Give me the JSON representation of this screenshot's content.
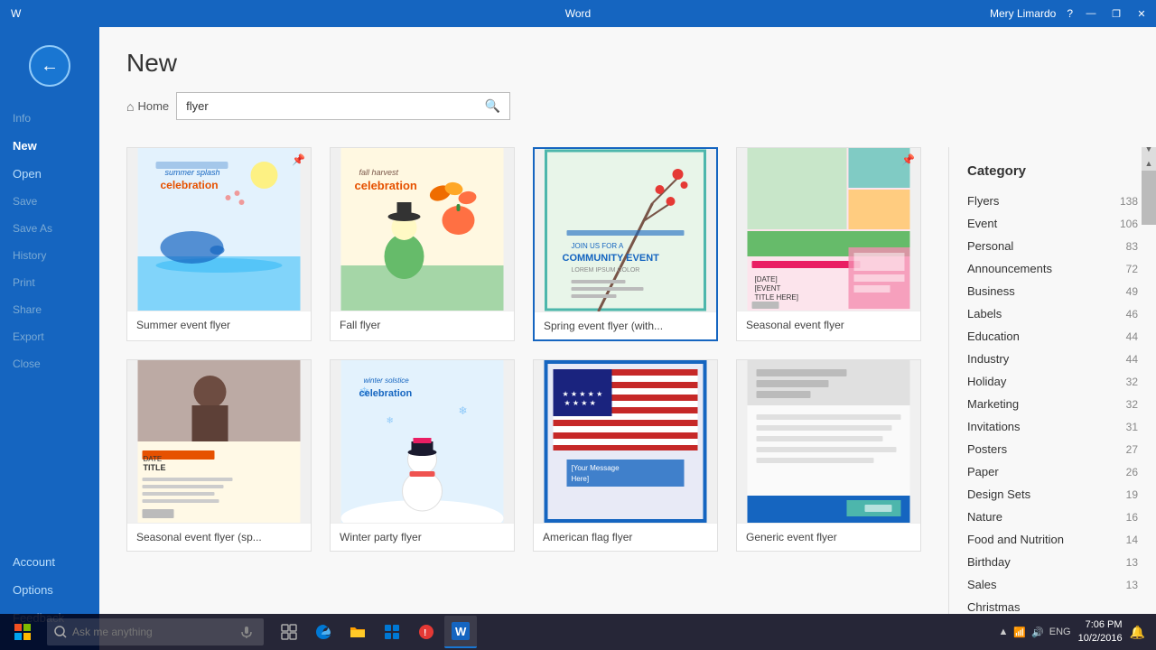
{
  "titlebar": {
    "app_name": "Word",
    "user": "Mery Limardo",
    "help_icon": "?",
    "minimize": "—",
    "maximize": "❐",
    "close": "✕"
  },
  "sidebar": {
    "back_icon": "←",
    "items": [
      {
        "id": "info",
        "label": "Info",
        "active": false,
        "dimmed": true
      },
      {
        "id": "new",
        "label": "New",
        "active": true,
        "dimmed": false
      },
      {
        "id": "open",
        "label": "Open",
        "active": false,
        "dimmed": false
      },
      {
        "id": "save",
        "label": "Save",
        "active": false,
        "dimmed": true
      },
      {
        "id": "save-as",
        "label": "Save As",
        "active": false,
        "dimmed": true
      },
      {
        "id": "history",
        "label": "History",
        "active": false,
        "dimmed": true
      },
      {
        "id": "print",
        "label": "Print",
        "active": false,
        "dimmed": true
      },
      {
        "id": "share",
        "label": "Share",
        "active": false,
        "dimmed": true
      },
      {
        "id": "export",
        "label": "Export",
        "active": false,
        "dimmed": true
      },
      {
        "id": "close",
        "label": "Close",
        "active": false,
        "dimmed": true
      }
    ],
    "bottom_items": [
      {
        "id": "account",
        "label": "Account"
      },
      {
        "id": "options",
        "label": "Options"
      },
      {
        "id": "feedback",
        "label": "Feedback"
      }
    ]
  },
  "main": {
    "title": "New",
    "search": {
      "home_label": "Home",
      "placeholder": "flyer",
      "value": "flyer",
      "search_icon": "🔍"
    },
    "templates": [
      {
        "id": "summer",
        "label": "Summer event flyer",
        "pinned": true,
        "pin_icon": "📌",
        "color1": "#e3f2fd",
        "color2": "#81d4fa",
        "type": "summer"
      },
      {
        "id": "fall",
        "label": "Fall flyer",
        "pinned": false,
        "color1": "#fff8e1",
        "color2": "#a5d6a7",
        "type": "fall"
      },
      {
        "id": "spring",
        "label": "Spring event flyer (with...",
        "pinned": false,
        "color1": "#e8f5e9",
        "color2": "#c8e6c9",
        "type": "spring"
      },
      {
        "id": "seasonal",
        "label": "Seasonal event flyer",
        "pinned": false,
        "pin_icon": "📌",
        "color1": "#f3e5f5",
        "color2": "#e1bee7",
        "type": "seasonal"
      },
      {
        "id": "seasonal-sp",
        "label": "Seasonal event flyer (sp...",
        "pinned": false,
        "color1": "#fff9e6",
        "color2": "#c8b88a",
        "type": "sp2"
      },
      {
        "id": "winter",
        "label": "Winter party flyer",
        "pinned": false,
        "color1": "#e3f2fd",
        "color2": "#b3e5fc",
        "type": "winter"
      },
      {
        "id": "american",
        "label": "American flag flyer",
        "pinned": false,
        "color1": "#e8eaf6",
        "color2": "#c5cae9",
        "type": "flag"
      },
      {
        "id": "generic",
        "label": "Generic event flyer",
        "pinned": false,
        "color1": "#fafafa",
        "color2": "#e0e0e0",
        "type": "generic"
      }
    ],
    "categories": {
      "title": "Category",
      "items": [
        {
          "name": "Flyers",
          "count": 138
        },
        {
          "name": "Event",
          "count": 106
        },
        {
          "name": "Personal",
          "count": 83
        },
        {
          "name": "Announcements",
          "count": 72
        },
        {
          "name": "Business",
          "count": 49
        },
        {
          "name": "Labels",
          "count": 46
        },
        {
          "name": "Education",
          "count": 44
        },
        {
          "name": "Industry",
          "count": 44
        },
        {
          "name": "Holiday",
          "count": 32
        },
        {
          "name": "Marketing",
          "count": 32
        },
        {
          "name": "Invitations",
          "count": 31
        },
        {
          "name": "Posters",
          "count": 27
        },
        {
          "name": "Paper",
          "count": 26
        },
        {
          "name": "Design Sets",
          "count": 19
        },
        {
          "name": "Nature",
          "count": 16
        },
        {
          "name": "Food and Nutrition",
          "count": 14
        },
        {
          "name": "Birthday",
          "count": 13
        },
        {
          "name": "Sales",
          "count": 13
        },
        {
          "name": "Christmas",
          "count": ""
        }
      ]
    }
  },
  "taskbar": {
    "search_placeholder": "Ask me anything",
    "time": "7:06 PM",
    "date": "10/2/2016",
    "lang": "ENG"
  }
}
